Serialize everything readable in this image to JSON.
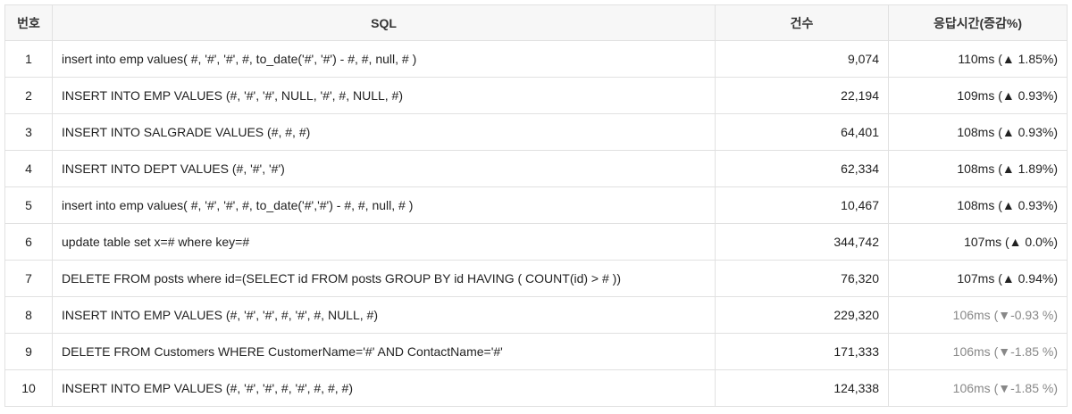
{
  "table": {
    "headers": {
      "num": "번호",
      "sql": "SQL",
      "count": "건수",
      "response": "응답시간(증감%)"
    },
    "rows": [
      {
        "num": "1",
        "sql": "insert into emp values( #, '#', '#', #, to_date('#', '#') - #, #, null, # )",
        "count": "9,074",
        "response": "110ms (▲ 1.85%)",
        "trend": "up"
      },
      {
        "num": "2",
        "sql": "INSERT INTO EMP VALUES (#, '#', '#', NULL, '#', #, NULL, #)",
        "count": "22,194",
        "response": "109ms (▲ 0.93%)",
        "trend": "up"
      },
      {
        "num": "3",
        "sql": "INSERT INTO SALGRADE VALUES (#, #, #)",
        "count": "64,401",
        "response": "108ms (▲ 0.93%)",
        "trend": "up"
      },
      {
        "num": "4",
        "sql": "INSERT INTO DEPT VALUES (#, '#', '#')",
        "count": "62,334",
        "response": "108ms (▲ 1.89%)",
        "trend": "up"
      },
      {
        "num": "5",
        "sql": "insert into emp values( #, '#', '#', #, to_date('#','#') - #, #, null, # )",
        "count": "10,467",
        "response": "108ms (▲ 0.93%)",
        "trend": "up"
      },
      {
        "num": "6",
        "sql": "update table set x=# where key=#",
        "count": "344,742",
        "response": "107ms (▲ 0.0%)",
        "trend": "up"
      },
      {
        "num": "7",
        "sql": "DELETE FROM posts where id=(SELECT id FROM posts GROUP BY id HAVING ( COUNT(id) > # ))",
        "count": "76,320",
        "response": "107ms (▲ 0.94%)",
        "trend": "up"
      },
      {
        "num": "8",
        "sql": "INSERT INTO EMP VALUES (#, '#', '#', #, '#', #, NULL, #)",
        "count": "229,320",
        "response": "106ms (▼-0.93 %)",
        "trend": "down"
      },
      {
        "num": "9",
        "sql": "DELETE FROM Customers WHERE CustomerName='#' AND ContactName='#'",
        "count": "171,333",
        "response": "106ms (▼-1.85 %)",
        "trend": "down"
      },
      {
        "num": "10",
        "sql": "INSERT INTO EMP VALUES (#, '#', '#', #, '#', #, #, #)",
        "count": "124,338",
        "response": "106ms (▼-1.85 %)",
        "trend": "down"
      }
    ]
  },
  "colors": {
    "header_bg": "#f7f7f7",
    "border": "#e1e1e1",
    "text": "#222222",
    "decrease_text": "#888888"
  }
}
